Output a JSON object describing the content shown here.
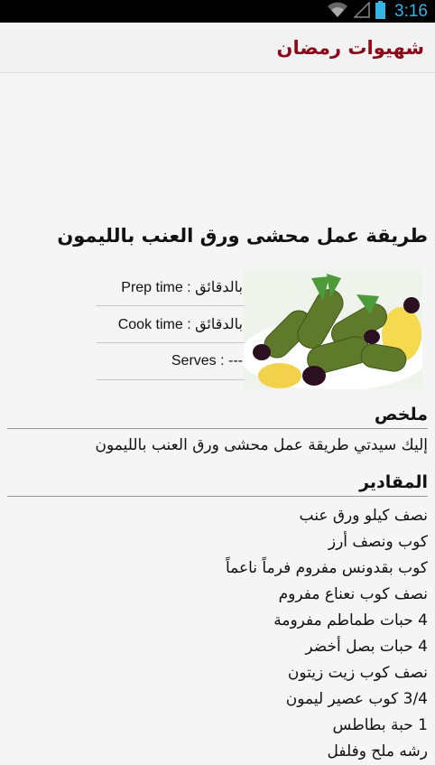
{
  "status_bar": {
    "time": "3:16",
    "icons": [
      "wifi-icon",
      "signal-icon",
      "battery-icon"
    ]
  },
  "app": {
    "title": "شهيوات رمضان"
  },
  "recipe": {
    "title": "طريقة عمل محشى ورق العنب بالليمون",
    "photo_alt": "stuffed-grape-leaves-with-lemon",
    "meta": {
      "prep": "Prep time : بالدقائق",
      "cook": "Cook time : بالدقائق",
      "serves": "Serves : ---"
    }
  },
  "summary": {
    "heading": "ملخص",
    "text": "إليك سيدتي طريقة عمل محشى ورق العنب بالليمون"
  },
  "ingredients": {
    "heading": "المقادير",
    "items": [
      "نصف كيلو ورق عنب",
      "كوب ونصف أرز",
      "كوب بقدونس مفروم فرماً ناعماً",
      "نصف كوب نعناع مفروم",
      "4 حبات طماطم مفرومة",
      "4 حبات بصل أخضر",
      "نصف كوب زيت زيتون",
      "3/4 كوب عصير ليمون",
      "1 حبة بطاطس",
      "رشه ملح وفلفل"
    ]
  },
  "colors": {
    "accent": "#8b0a1a",
    "status_blue": "#33b5e5"
  }
}
